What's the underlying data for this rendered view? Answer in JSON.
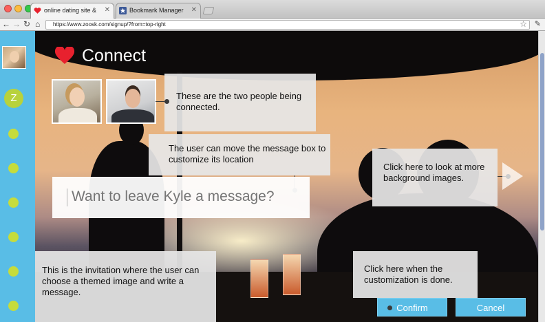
{
  "browser": {
    "tabs": [
      {
        "title": "online dating site &",
        "active": true
      },
      {
        "title": "Bookmark Manager",
        "active": false
      }
    ],
    "address": "https://www.zoosk.com/signup/?from=top-right",
    "icons": [
      "back-arrow-icon",
      "forward-arrow-icon",
      "reload-icon",
      "home-icon",
      "star-icon",
      "wrench-icon"
    ]
  },
  "sidebar": {
    "logo_letter": "Z",
    "dot_count": 6,
    "color": "#59bde6",
    "dot_color": "#c6dc3c"
  },
  "page": {
    "title": "Connect",
    "heart_color": "#e8212e"
  },
  "callouts": {
    "people": "These are the two people being connected.",
    "move": "The user can move the message box to customize its location",
    "background": "Click here to look at more background images.",
    "invitation": "This is the invitation where the user can choose a themed image and write a message.",
    "done": "Click here when the customization is done."
  },
  "message": {
    "placeholder": "Want to leave Kyle a message?"
  },
  "buttons": {
    "confirm": "Confirm",
    "cancel": "Cancel",
    "color": "#59bde6"
  }
}
